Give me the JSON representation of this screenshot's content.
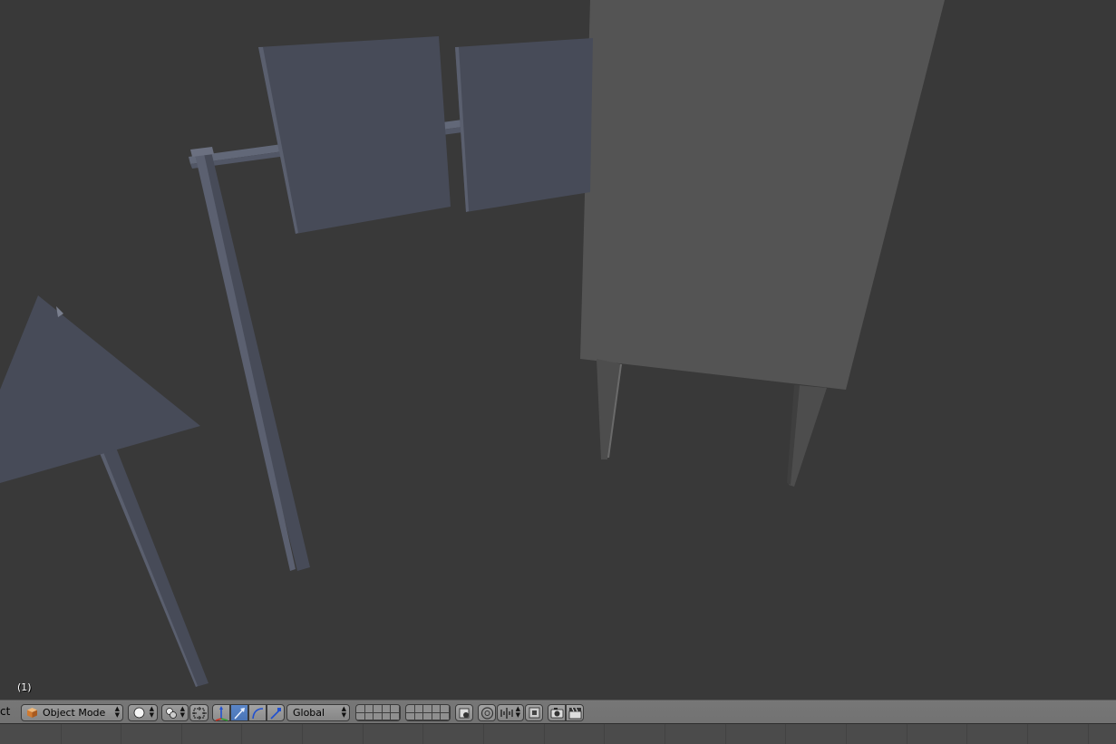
{
  "viewport": {
    "frame_label": "(1)"
  },
  "header": {
    "menu_stub": "ct",
    "mode_dropdown": {
      "label": "Object Mode",
      "icon": "cube-icon"
    },
    "shading_dropdown": {
      "icon": "solid-sphere-icon"
    },
    "pivot_dropdown": {
      "icon": "pivot-point-icon"
    },
    "manipulator_toggle": {
      "icon": "manipulator-icon"
    },
    "manipulators": [
      {
        "name": "translate",
        "icon": "translate-arrow-icon",
        "active": false
      },
      {
        "name": "translate-mode",
        "icon": "arrow-icon",
        "active": true
      },
      {
        "name": "rotate",
        "icon": "rotate-arc-icon",
        "active": false
      },
      {
        "name": "scale",
        "icon": "scale-icon",
        "active": false
      }
    ],
    "orientation_dropdown": {
      "label": "Global"
    },
    "layers": {
      "group_count": 2,
      "columns": 5,
      "rows": 2
    },
    "lock_layer_icon": "lock-layer-icon",
    "proportional_edit_icon": "proportional-edit-icon",
    "snap_icon": "snap-icon",
    "render_icons": [
      "camera-icon",
      "clapperboard-icon"
    ]
  },
  "colors": {
    "background": "#393939",
    "header": "#757575",
    "timeline": "#4b4b4b",
    "object_blue": "#474b58",
    "object_grey": "#545454",
    "active_button": "#5680c0"
  }
}
